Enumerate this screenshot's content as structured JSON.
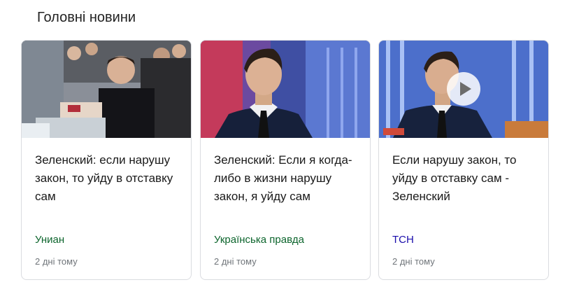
{
  "section": {
    "title": "Головні новини"
  },
  "cards": [
    {
      "headline": "Зеленский: если нарушу закон, то уйду в отставку сам",
      "source": "Униан",
      "time": "2 дні тому"
    },
    {
      "headline": "Зеленский: Если я когда-либо в жизни нарушу закон, я уйду сам",
      "source": "Українська правда",
      "time": "2 дні тому"
    },
    {
      "headline": "Если нарушу закон, то уйду в отставку сам - Зеленский",
      "source": "ТСН",
      "time": "2 дні тому",
      "has_video": true
    }
  ],
  "colors": {
    "source_green": "#0d652d",
    "source_link": "#1a0dab",
    "meta_gray": "#70757a"
  }
}
